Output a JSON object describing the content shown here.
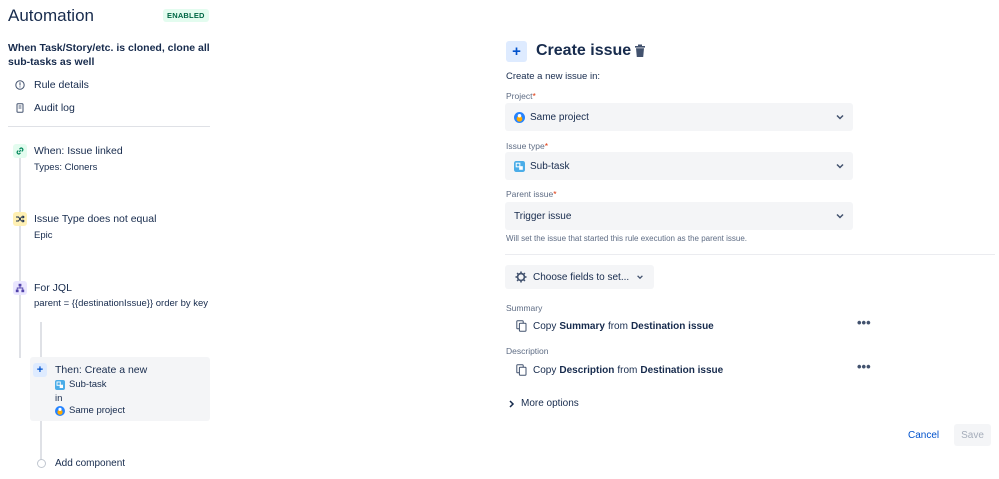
{
  "app": {
    "title": "Automation",
    "status_badge": "ENABLED"
  },
  "rule": {
    "name": "When Task/Story/etc. is cloned, clone all sub-tasks as well"
  },
  "nav": [
    {
      "label": "Rule details",
      "icon": "info-icon"
    },
    {
      "label": "Audit log",
      "icon": "document-icon"
    }
  ],
  "flow": {
    "trigger": {
      "title": "When: Issue linked",
      "subtitle": "Types: Cloners",
      "icon": "link-icon"
    },
    "condition": {
      "title": "Issue Type does not equal",
      "subtitle": "Epic",
      "icon": "shuffle-icon"
    },
    "branch": {
      "title": "For JQL",
      "subtitle": "parent = {{destinationIssue}} order by key",
      "icon": "branch-icon"
    },
    "action": {
      "title": "Then: Create a new",
      "issue_type": "Sub-task",
      "connector": "in",
      "project": "Same project"
    },
    "add_component": "Add component"
  },
  "editor": {
    "title": "Create issue",
    "intro": "Create a new issue in:",
    "fields": {
      "project": {
        "label": "Project",
        "value": "Same project"
      },
      "issue_type": {
        "label": "Issue type",
        "value": "Sub-task"
      },
      "parent_issue": {
        "label": "Parent issue",
        "value": "Trigger issue",
        "hint": "Will set the issue that started this rule execution as the parent issue."
      }
    },
    "choose_fields": "Choose fields to set...",
    "summary": {
      "label": "Summary",
      "prefix": "Copy",
      "field": "Summary",
      "middle": "from",
      "source": "Destination issue"
    },
    "description": {
      "label": "Description",
      "prefix": "Copy",
      "field": "Description",
      "middle": "from",
      "source": "Destination issue"
    },
    "more_options": "More options",
    "cancel": "Cancel",
    "save": "Save"
  },
  "colors": {
    "accent": "#0052cc",
    "badge_bg": "#e3fcef",
    "badge_text": "#006644",
    "required": "#de350b",
    "field_bg": "#f4f5f7"
  }
}
